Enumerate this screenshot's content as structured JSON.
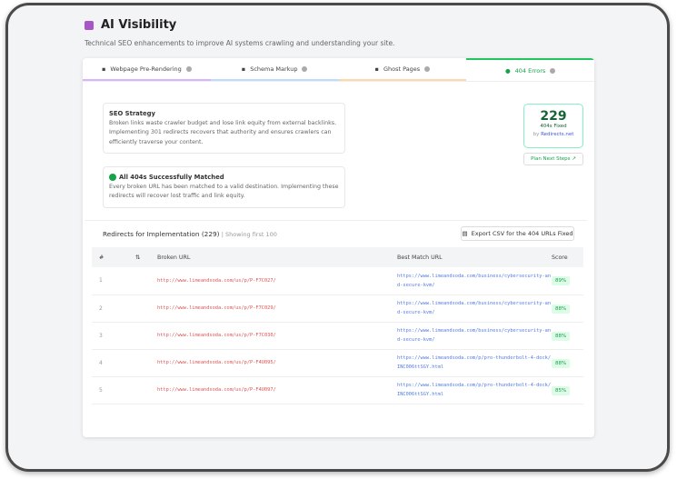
{
  "header": {
    "title": "AI Visibility",
    "subtitle": "Technical SEO enhancements to improve AI systems crawling and understanding your site."
  },
  "tabs": [
    {
      "label": "Webpage Pre-Rendering",
      "color": "#d8b4fe"
    },
    {
      "label": "Schema Markup",
      "color": "#bfdbfe"
    },
    {
      "label": "Ghost Pages",
      "color": "#fed7aa"
    },
    {
      "label": "404 Errors",
      "color": "#22c55e"
    }
  ],
  "strategy": {
    "title": "SEO Strategy",
    "text": "Broken links waste crawler budget and lose link equity from external backlinks. Implementing 301 redirects recovers that authority and ensures crawlers can efficiently traverse your content."
  },
  "matched": {
    "title": "All 404s Successfully Matched",
    "text": "Every broken URL has been matched to a valid destination. Implementing these redirects will recover lost traffic and link equity."
  },
  "stat": {
    "value": "229",
    "label": "404s Fixed",
    "by": "by",
    "brand": "Redirects.net"
  },
  "plan_button": "Plan Next Steps",
  "redirects": {
    "title": "Redirects for Implementation (229)",
    "note": "| Showing first 100",
    "export": "Export CSV for the 404 URLs Fixed"
  },
  "table": {
    "headers": [
      "#",
      "",
      "Broken URL",
      "Best Match URL",
      "Score"
    ],
    "rows": [
      {
        "n": "1",
        "broken": "http://www.limeandsoda.com/us/p/P-F7C027/",
        "match": "https://www.limeandsoda.com/business/cybersecurity-and-secure-kvm/",
        "score": "89%"
      },
      {
        "n": "2",
        "broken": "http://www.limeandsoda.com/us/p/P-F7C029/",
        "match": "https://www.limeandsoda.com/business/cybersecurity-and-secure-kvm/",
        "score": "88%"
      },
      {
        "n": "3",
        "broken": "http://www.limeandsoda.com/us/p/P-F7C030/",
        "match": "https://www.limeandsoda.com/business/cybersecurity-and-secure-kvm/",
        "score": "88%"
      },
      {
        "n": "4",
        "broken": "http://www.limeandsoda.com/us/p/P-F4U095/",
        "match": "https://www.limeandsoda.com/p/pro-thunderbolt-4-dock/INC006ttSGY.html",
        "score": "88%"
      },
      {
        "n": "5",
        "broken": "http://www.limeandsoda.com/us/p/P-F4U097/",
        "match": "https://www.limeandsoda.com/p/pro-thunderbolt-4-dock/INC006ttSGY.html",
        "score": "85%"
      }
    ]
  }
}
